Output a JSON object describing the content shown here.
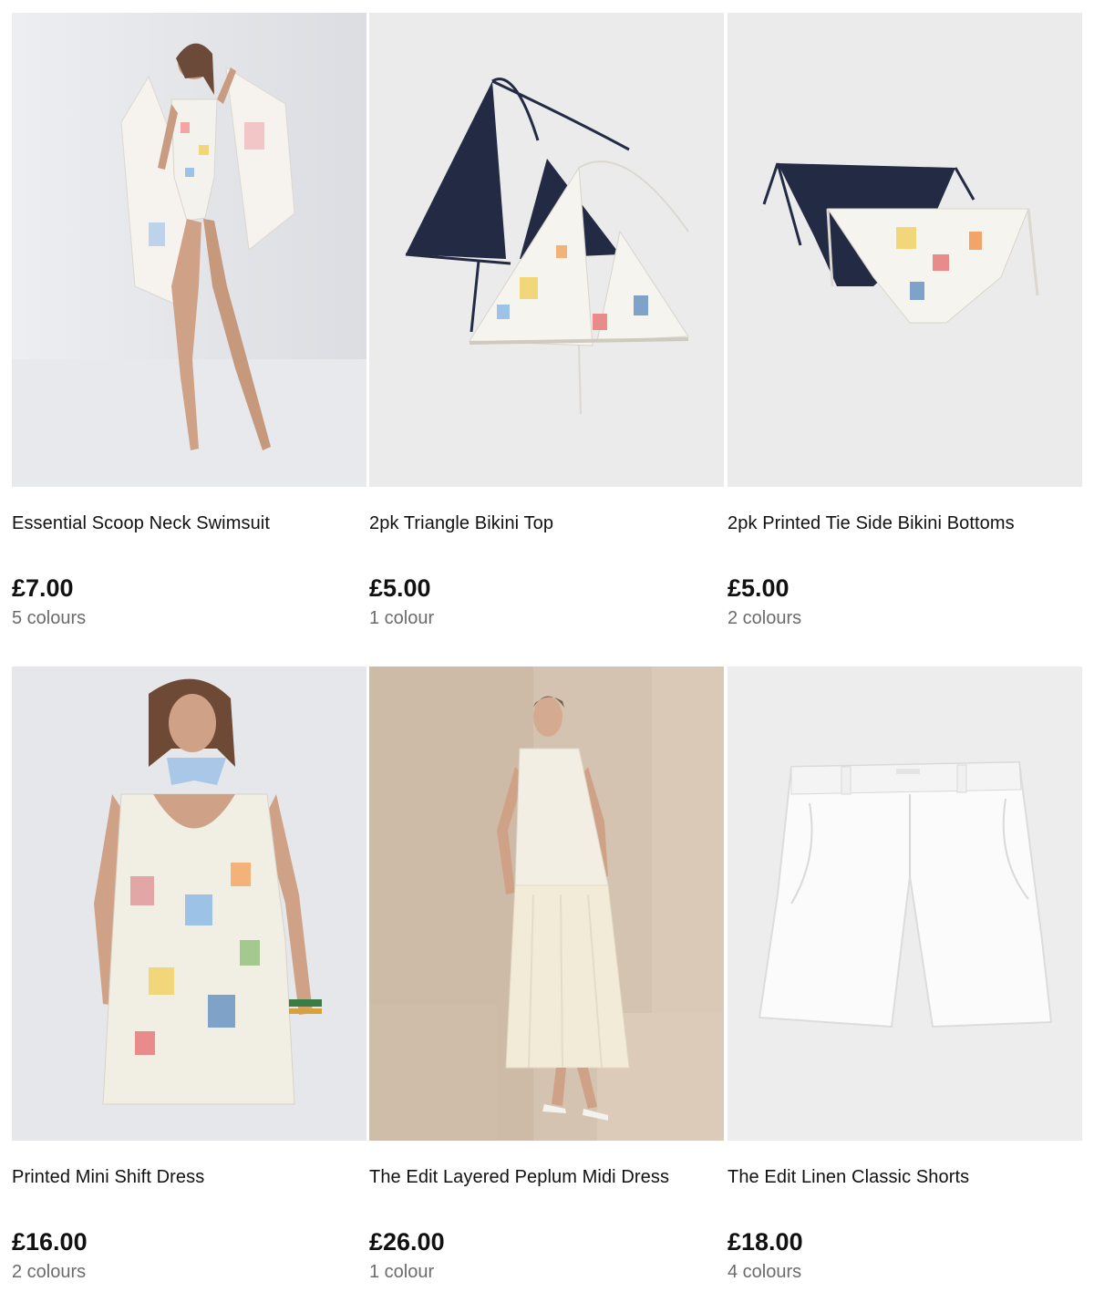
{
  "products": [
    {
      "title": "Essential Scoop Neck Swimsuit",
      "price": "£7.00",
      "colours": "5 colours"
    },
    {
      "title": "2pk Triangle Bikini Top",
      "price": "£5.00",
      "colours": "1 colour"
    },
    {
      "title": "2pk Printed Tie Side Bikini Bottoms",
      "price": "£5.00",
      "colours": "2 colours"
    },
    {
      "title": "Printed Mini Shift Dress",
      "price": "£16.00",
      "colours": "2 colours"
    },
    {
      "title": "The Edit Layered Peplum Midi Dress",
      "price": "£26.00",
      "colours": "1 colour"
    },
    {
      "title": "The Edit Linen Classic Shorts",
      "price": "£18.00",
      "colours": "4 colours"
    }
  ],
  "colors": {
    "studio_bg": "#e4e4e6",
    "beige_bg": "#d6c6b3",
    "navy": "#1f2740",
    "print_white": "#f3f1ea",
    "price_text": "#111111",
    "muted_text": "#6b6b6b"
  }
}
